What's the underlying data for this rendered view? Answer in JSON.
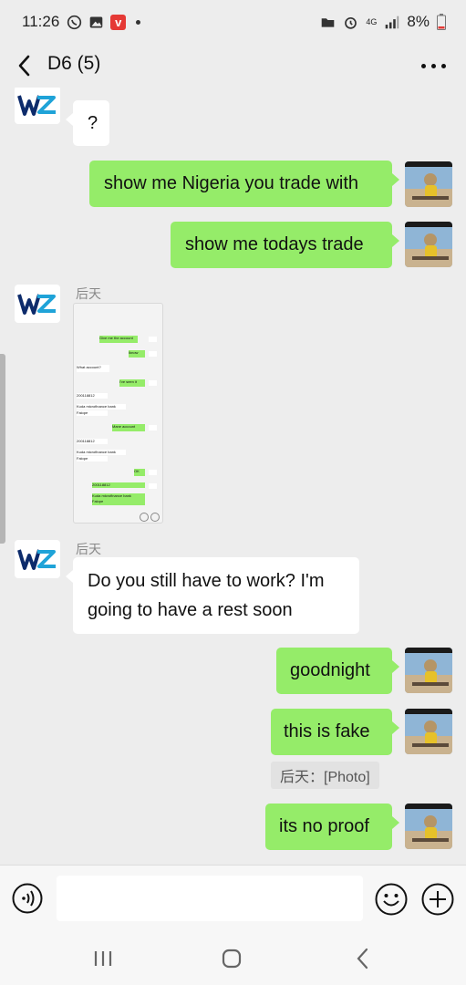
{
  "status_bar": {
    "time": "11:26",
    "battery": "8%",
    "network": "4G"
  },
  "header": {
    "title": "D6 (5)"
  },
  "messages": [
    {
      "side": "in",
      "text": "?"
    },
    {
      "side": "out",
      "text": "show me Nigeria you trade with"
    },
    {
      "side": "out",
      "text": "show me todays trade"
    },
    {
      "side": "in",
      "sender": "后天",
      "type": "image",
      "thumbnail": {
        "lines": [
          "Give me the account",
          "Iknow",
          "What account?",
          "I've seen it",
          "200118812",
          "Kuda microfinance bank",
          "Falope",
          "Mane account",
          "200118812",
          "Kuda microfinance bank",
          "Falope",
          "OK",
          "200118812",
          "Kuda microfinance bank",
          "Falope"
        ]
      }
    },
    {
      "side": "in",
      "sender": "后天",
      "text": "Do you still have to work? I'm going to have a rest soon"
    },
    {
      "side": "out",
      "text": "goodnight"
    },
    {
      "side": "out",
      "text": "this is fake",
      "quote": "后天：[Photo]"
    },
    {
      "side": "out",
      "text": "its no proof"
    }
  ],
  "input": {
    "placeholder": ""
  },
  "icons": {
    "back": "chevron-left-icon",
    "more": "more-dots-icon",
    "voice": "voice-icon",
    "emoji": "emoji-icon",
    "plus": "plus-icon"
  },
  "colors": {
    "outgoing_bubble": "#95ec69",
    "incoming_bubble": "#ffffff",
    "background": "#ededed"
  }
}
